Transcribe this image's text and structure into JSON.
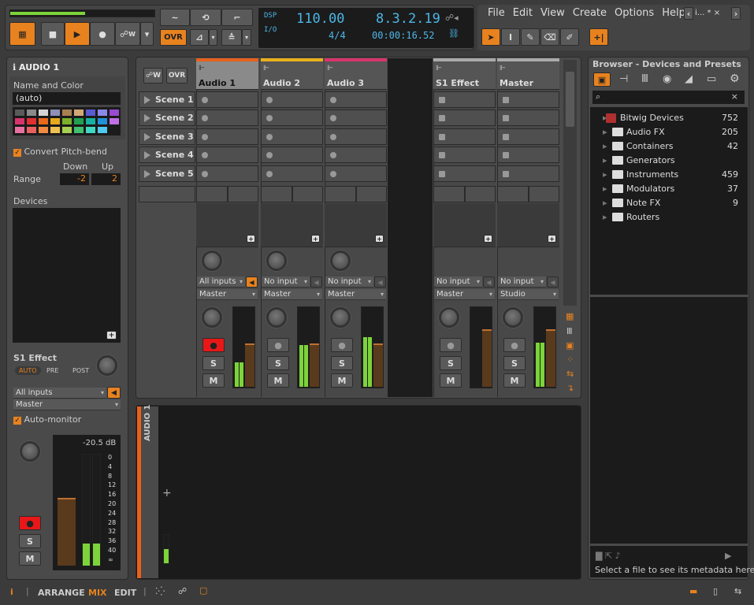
{
  "transport": {
    "overwrite_label": "OVR",
    "automation_write_label": "W",
    "dsp_label": "DSP",
    "io_label": "I/O",
    "tempo": "110.00",
    "time_signature": "4/4",
    "position": "8.3.2.19",
    "time": "00:00:16.52"
  },
  "menu": {
    "items": [
      "File",
      "Edit",
      "View",
      "Create",
      "Options",
      "Help"
    ],
    "tab_label": "i...",
    "tab_modified": "*"
  },
  "inspector": {
    "track_name": "AUDIO 1",
    "name_color_label": "Name and Color",
    "name_value": "(auto)",
    "palette": [
      "#5a5a5a",
      "#8a8a8a",
      "#d4d4d4",
      "#8f8fb8",
      "#a88050",
      "#d2a878",
      "#5a5ad2",
      "#8a8ae6",
      "#9a4ad2",
      "#d8346c",
      "#e03030",
      "#e86a1c",
      "#e8a81c",
      "#7ab02a",
      "#20a050",
      "#18b0a0",
      "#2090d8",
      "#c070e6",
      "#e870a0",
      "#e86060",
      "#f08a40",
      "#f0c050",
      "#a8d050",
      "#40c070",
      "#40d8c0",
      "#50c8f0"
    ],
    "convert_pitch_bend": "Convert Pitch-bend",
    "down_label": "Down",
    "up_label": "Up",
    "range_label": "Range",
    "range_down": "-2",
    "range_up": "2",
    "devices_label": "Devices",
    "send_label": "S1 Effect",
    "send_modes": [
      "AUTO",
      "PRE",
      "POST"
    ],
    "input": "All inputs",
    "output": "Master",
    "auto_monitor": "Auto-monitor",
    "volume_db": "-20.5 dB",
    "meter_scale": [
      "0",
      "4",
      "8",
      "12",
      "16",
      "20",
      "24",
      "28",
      "32",
      "36",
      "40",
      "∞"
    ],
    "solo": "S",
    "mute": "M"
  },
  "mixer": {
    "automation_label": "W",
    "ovr_label": "OVR",
    "scenes": [
      "Scene 1",
      "Scene 2",
      "Scene 3",
      "Scene 4",
      "Scene 5"
    ],
    "tracks": [
      {
        "name": "Audio 1",
        "color": "#e8601c",
        "input": "All inputs",
        "output": "Master",
        "monitor": true,
        "armed": true,
        "level": 0.3,
        "volume": 0.6
      },
      {
        "name": "Audio 2",
        "color": "#e8b01c",
        "input": "No input",
        "output": "Master",
        "monitor": false,
        "armed": false,
        "level": 0.52,
        "volume": 0.6
      },
      {
        "name": "Audio 3",
        "color": "#d8346c",
        "input": "No input",
        "output": "Master",
        "monitor": false,
        "armed": false,
        "level": 0.62,
        "volume": 0.6
      },
      {
        "name": "S1 Effect",
        "color": "#aaaaaa",
        "input": "No input",
        "output": "Master",
        "monitor": false,
        "armed": false,
        "level": 0,
        "volume": 0.8
      },
      {
        "name": "Master",
        "color": "#aaaaaa",
        "input": "No input",
        "output": "Studio",
        "monitor": false,
        "armed": false,
        "level": 0.55,
        "volume": 0.8
      }
    ],
    "solo": "S",
    "mute": "M"
  },
  "detail": {
    "track_label": "AUDIO 1"
  },
  "browser": {
    "title": "Browser - Devices and Presets",
    "root": {
      "label": "Bitwig Devices",
      "count": "752"
    },
    "items": [
      {
        "label": "Audio FX",
        "count": "205"
      },
      {
        "label": "Containers",
        "count": "42"
      },
      {
        "label": "Generators",
        "count": ""
      },
      {
        "label": "Instruments",
        "count": "459"
      },
      {
        "label": "Modulators",
        "count": "37"
      },
      {
        "label": "Note FX",
        "count": "9"
      },
      {
        "label": "Routers",
        "count": ""
      }
    ],
    "metadata_hint": "Select a file to see its metadata here"
  },
  "bottom": {
    "views": [
      "ARRANGE",
      "MIX",
      "EDIT"
    ],
    "active_view": "MIX"
  },
  "colors": {
    "accent": "#e8821e",
    "meter_green": "#7cd43a",
    "display_text": "#4db6e6"
  }
}
